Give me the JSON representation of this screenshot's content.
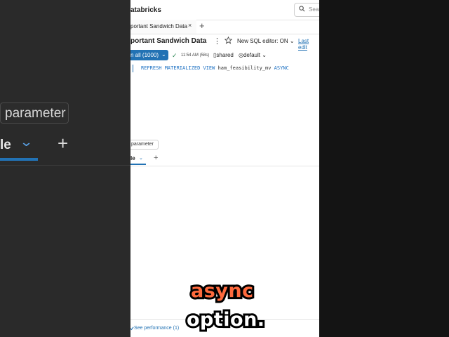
{
  "background": {
    "parameter_label": "parameter",
    "tab_label": "le",
    "tab_chevron": "⌄",
    "tab_add": "+"
  },
  "header": {
    "brand": "atabricks",
    "search_placeholder": "Sear"
  },
  "tabs": {
    "active_title": "portant Sandwich Data",
    "close": "×",
    "add": "+"
  },
  "query": {
    "title": "portant Sandwich Data",
    "kebab": "⋮",
    "sql_editor_toggle": "New SQL editor: ON ⌄",
    "last_edit": "Last edit"
  },
  "run": {
    "label": "n all (1000)",
    "chevron": "⌄",
    "status_time": "11:54 AM (58s)",
    "catalog": "shared",
    "schema": "default ⌄"
  },
  "editor": {
    "keyword1": "REFRESH MATERIALIZED VIEW",
    "identifier": "ham_feasibility_mv",
    "keyword2": "ASYNC"
  },
  "parameter_button": "parameter",
  "results": {
    "tab_label": "le",
    "chevron": "⌄",
    "add": "+"
  },
  "footer": {
    "performance_link": "See performance (1)"
  },
  "captions": {
    "line1": "async",
    "line2": "option."
  },
  "colors": {
    "accent": "#2272b4",
    "caption_highlight": "#ff6a3d"
  }
}
